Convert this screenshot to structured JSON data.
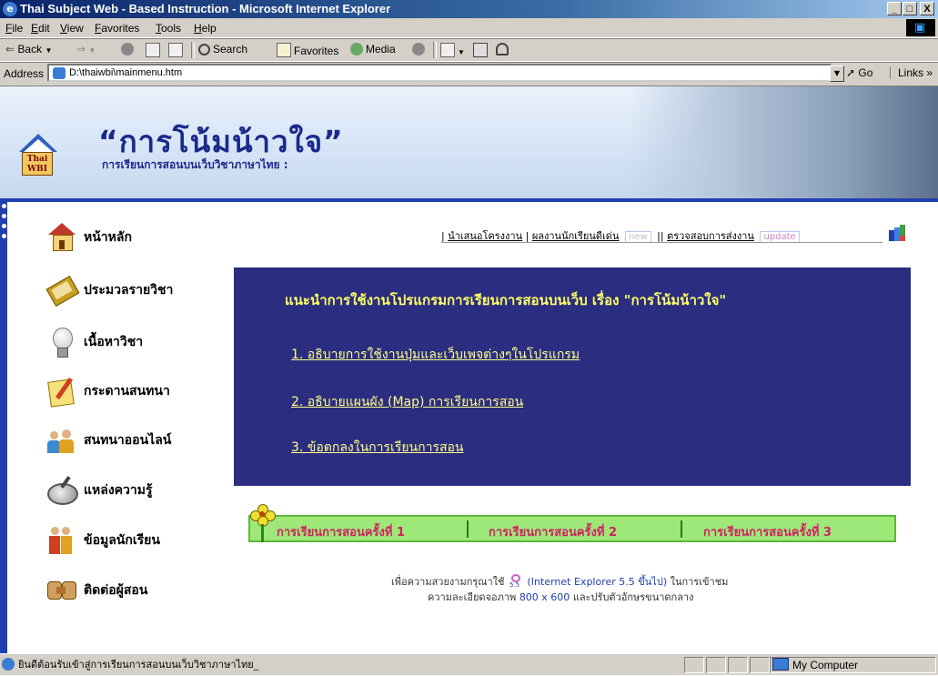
{
  "window": {
    "title": "Thai Subject Web - Based Instruction - Microsoft Internet Explorer",
    "controls": {
      "minimize": "_",
      "maximize": "□",
      "close": "X"
    }
  },
  "menu": [
    "File",
    "Edit",
    "View",
    "Favorites",
    "Tools",
    "Help"
  ],
  "toolbar": {
    "back": "Back",
    "search": "Search",
    "favorites": "Favorites",
    "media": "Media"
  },
  "address": {
    "label": "Address",
    "value": "D:\\thaiwbi\\mainmenu.htm",
    "go": "Go",
    "links": "Links »"
  },
  "banner": {
    "logo_text_1": "Thai",
    "logo_text_2": "WBI",
    "title": "“การโน้มน้าวใจ”",
    "subtitle": "การเรียนการสอนบนเว็บวิชาภาษาไทย :"
  },
  "nav": [
    {
      "label": "หน้าหลัก",
      "icon": "home-icon"
    },
    {
      "label": "ประมวลรายวิชา",
      "icon": "book-icon"
    },
    {
      "label": "เนื้อหาวิชา",
      "icon": "lightbulb-icon"
    },
    {
      "label": "กระดานสนทนา",
      "icon": "notepad-icon"
    },
    {
      "label": "สนทนาออนไลน์",
      "icon": "people-icon"
    },
    {
      "label": "แหล่งความรู้",
      "icon": "magnifier-icon"
    },
    {
      "label": "ข้อมูลนักเรียน",
      "icon": "students-icon"
    },
    {
      "label": "ติดต่อผู้สอน",
      "icon": "handshake-icon"
    }
  ],
  "toplinks": {
    "link1": "นำเสนอโครงงาน",
    "link2": "ผลงานนักเรียนดีเด่น",
    "badge_new": "new",
    "link3": "ตรวจสอบการส่งงาน",
    "badge_update": "update"
  },
  "panel": {
    "title": "แนะนำการใช้งานโปรแกรมการเรียนการสอนบนเว็บ เรื่อง \"การโน้มน้าวใจ\"",
    "links": [
      "1. อธิบายการใช้งานปุ่มและเว็บเพจต่างๆในโปรแกรม",
      "2. อธิบายแผนผัง (Map) การเรียนการสอน",
      "3. ข้อตกลงในการเรียนการสอน"
    ]
  },
  "lessons": [
    "การเรียนการสอนครั้งที่ 1",
    "การเรียนการสอนครั้งที่ 2",
    "การเรียนการสอนครั้งที่ 3"
  ],
  "footnote": {
    "line1_pre": "เพื่อความสวยงามกรุณาใช้",
    "ie_mini": "5.5",
    "line1_highlight": "(Internet Explorer 5.5 ขึ้นไป)",
    "line1_post": "ในการเข้าชม",
    "line2_pre": "ความละเอียดจอภาพ",
    "line2_highlight": "800 x 600",
    "line2_post": "และปรับตัวอักษรขนาดกลาง"
  },
  "status": {
    "text": "ยินดีต้อนรับเข้าสู่การเรียนการสอนบนเว็บวิชาภาษาไทย_",
    "zone": "My Computer"
  },
  "colors": {
    "panel_bg": "#2b2d80",
    "panel_title": "#ffff66",
    "lesson_text": "#d02060",
    "lesson_bg": "#9ee87a",
    "banner_title": "#1a2a8a",
    "accent_blue": "#2040b0"
  }
}
